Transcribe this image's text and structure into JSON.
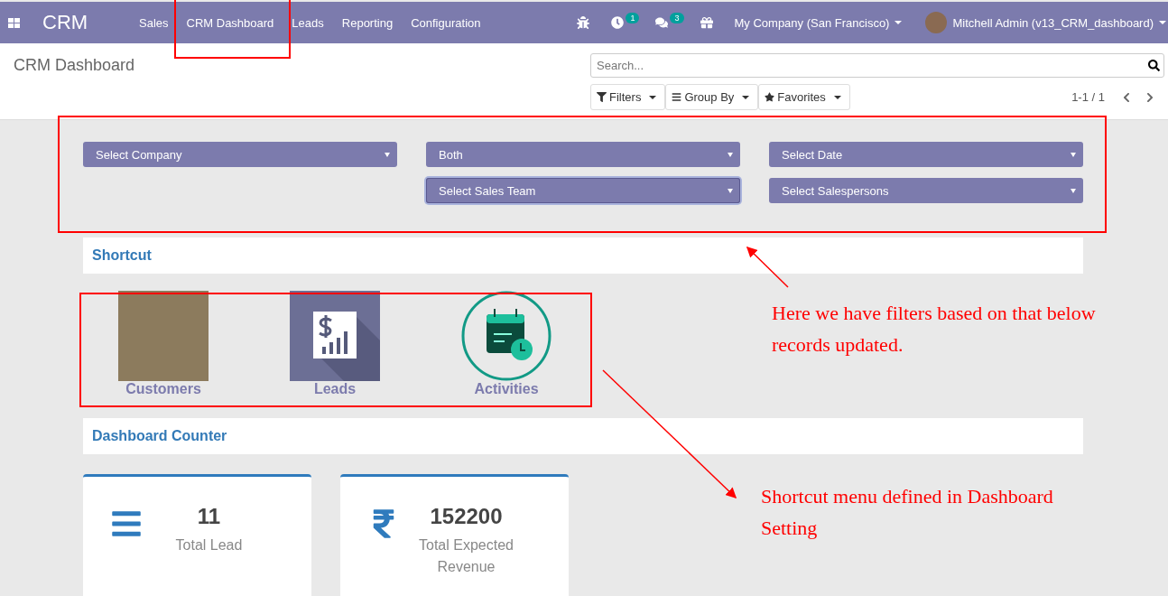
{
  "navbar": {
    "app_title": "CRM",
    "menu": [
      "Sales",
      "CRM Dashboard",
      "Leads",
      "Reporting",
      "Configuration"
    ],
    "activity_badge": "1",
    "message_badge": "3",
    "company": "My Company (San Francisco)",
    "user": "Mitchell Admin (v13_CRM_dashboard)"
  },
  "control_panel": {
    "breadcrumb": "CRM Dashboard",
    "search": {
      "placeholder": "Search..."
    },
    "buttons": [
      {
        "kind": "filter",
        "label": "Filters"
      },
      {
        "kind": "group",
        "label": "Group By"
      },
      {
        "kind": "star",
        "label": "Favorites"
      }
    ],
    "pager": "1-1 / 1"
  },
  "filter_columns": [
    [
      {
        "label": "Select Company",
        "focused": false
      }
    ],
    [
      {
        "label": "Both",
        "focused": false
      },
      {
        "label": "Select Sales Team",
        "focused": true
      }
    ],
    [
      {
        "label": "Select Date",
        "focused": false
      },
      {
        "label": "Select Salespersons",
        "focused": false
      }
    ]
  ],
  "shortcut": {
    "title": "Shortcut",
    "items": [
      {
        "kind": "photo",
        "label": "Customers"
      },
      {
        "kind": "report",
        "label": "Leads"
      },
      {
        "kind": "calendar",
        "label": "Activities"
      }
    ]
  },
  "counter": {
    "title": "Dashboard Counter",
    "cards": [
      {
        "kind": "list",
        "value": "11",
        "label": "Total Lead"
      },
      {
        "kind": "rupee",
        "value": "152200",
        "label": "Total Expected Revenue"
      }
    ]
  },
  "annotations": [
    "Here we have filters based on that below records updated.",
    "Shortcut menu defined in Dashboard Setting"
  ]
}
